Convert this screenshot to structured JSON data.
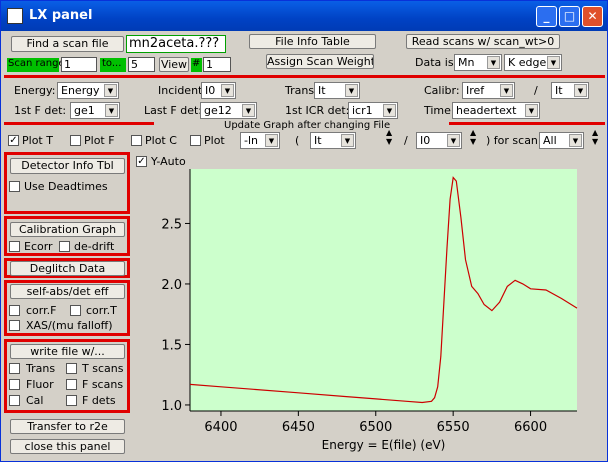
{
  "window": {
    "title": "LX panel",
    "min": "_",
    "max": "□",
    "close": "✕"
  },
  "row1": {
    "find_scan": "Find a scan file",
    "filename": "mn2aceta.???",
    "file_info": "File Info Table",
    "read_scans": "Read scans w/ scan_wt>0"
  },
  "row2": {
    "scan_range": "Scan range",
    "from": "1",
    "to_label": "to...",
    "to_val": "5",
    "view": "View",
    "hash": "#",
    "view_val": "1",
    "assign": "Assign Scan Weights",
    "data_is": "Data is",
    "element": "Mn",
    "edge": "K edge"
  },
  "row3": {
    "energy_lbl": "Energy:",
    "energy": "Energy",
    "incident_lbl": "Incident:",
    "incident": "I0",
    "trans_lbl": "Trans:",
    "trans": "It",
    "calibr_lbl": "Calibr:",
    "calibr": "Iref",
    "slash": "/",
    "calibr2": "It"
  },
  "row4": {
    "firstf_lbl": "1st F det:",
    "firstf": "ge1",
    "lastf_lbl": "Last F det:",
    "lastf": "ge12",
    "icr_lbl": "1st ICR det:",
    "icr": "icr1",
    "time_lbl": "Time:",
    "time": "headertext"
  },
  "update_label": "Update Graph after changing File",
  "row5": {
    "plot_t": "Plot T",
    "plot_f": "Plot F",
    "plot_c": "Plot C",
    "plot": "Plot",
    "ln": "-ln",
    "paren": "(",
    "it": "It",
    "slash": "/",
    "i0": "I0",
    "for_scan": ") for scan",
    "scan_sel": "All"
  },
  "yauto": "Y-Auto",
  "side": {
    "detector": "Detector Info Tbl",
    "deadtimes": "Use Deadtimes",
    "calgraph": "Calibration Graph",
    "ecorr": "Ecorr",
    "dedrift": "de-drift",
    "deglitch": "Deglitch Data",
    "selfabs": "self-abs/det eff",
    "corrf": "corr.F",
    "corrt": "corr.T",
    "xas": "XAS/(mu falloff)",
    "writefile": "write file w/...",
    "trans": "Trans",
    "tscans": "T scans",
    "fluor": "Fluor",
    "fscans": "F scans",
    "cal": "Cal",
    "fdets": "F dets",
    "transfer": "Transfer to r2e",
    "close": "close this panel"
  },
  "chart_data": {
    "type": "line",
    "xlabel": "Energy = E(file) (eV)",
    "ylabel": "",
    "xlim": [
      6380,
      6630
    ],
    "ylim": [
      0.95,
      2.95
    ],
    "xticks": [
      6400,
      6450,
      6500,
      6550,
      6600
    ],
    "yticks": [
      1.0,
      1.5,
      2.0,
      2.5
    ],
    "ytick_labels": [
      "1.0",
      "1.5",
      "2.0",
      "2.5"
    ],
    "series": [
      {
        "color": "#cc0000",
        "x": [
          6380,
          6400,
          6420,
          6450,
          6480,
          6500,
          6520,
          6530,
          6536,
          6538,
          6540,
          6542,
          6544,
          6546,
          6548,
          6550,
          6552,
          6555,
          6558,
          6562,
          6566,
          6570,
          6575,
          6580,
          6585,
          6590,
          6595,
          6600,
          6610,
          6620,
          6630
        ],
        "y": [
          1.17,
          1.15,
          1.13,
          1.1,
          1.07,
          1.05,
          1.03,
          1.02,
          1.03,
          1.06,
          1.15,
          1.4,
          1.85,
          2.3,
          2.7,
          2.88,
          2.85,
          2.55,
          2.2,
          1.98,
          1.92,
          1.83,
          1.78,
          1.85,
          1.98,
          2.03,
          2.0,
          1.96,
          1.95,
          1.88,
          1.8
        ]
      }
    ]
  }
}
